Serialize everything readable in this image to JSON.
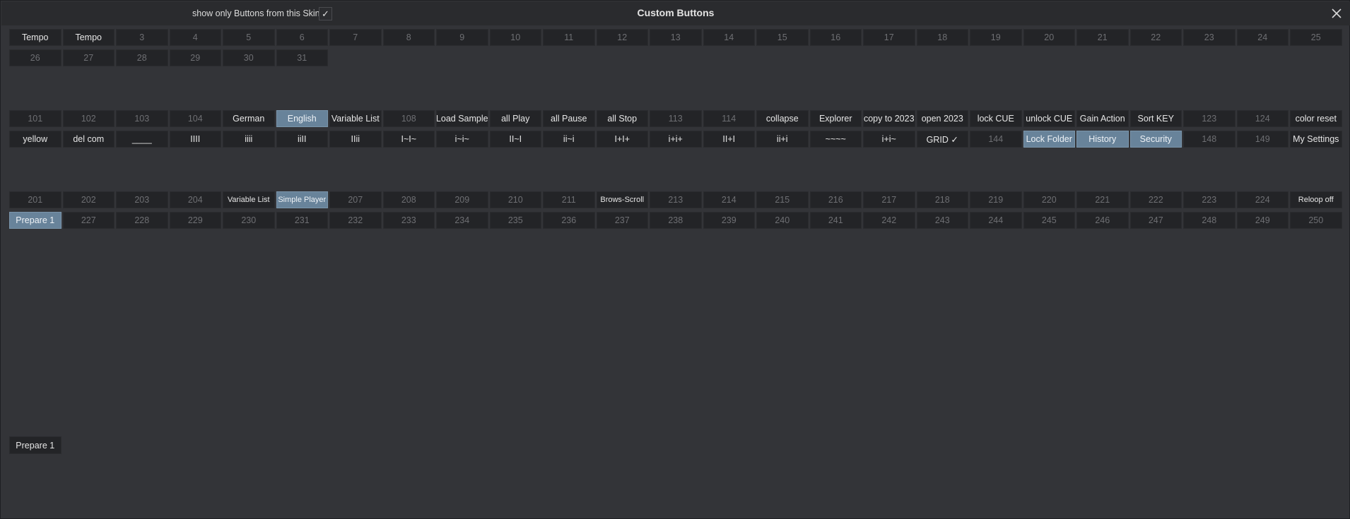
{
  "window": {
    "title": "Custom Buttons",
    "skin_filter_label": "show only Buttons from this Skin",
    "skin_filter_checked": "✓"
  },
  "groups": [
    [
      [
        {
          "label": "Tempo",
          "state": "assigned"
        },
        {
          "label": "Tempo",
          "state": "assigned"
        },
        {
          "label": "3",
          "state": "empty"
        },
        {
          "label": "4",
          "state": "empty"
        },
        {
          "label": "5",
          "state": "empty"
        },
        {
          "label": "6",
          "state": "empty"
        },
        {
          "label": "7",
          "state": "empty"
        },
        {
          "label": "8",
          "state": "empty"
        },
        {
          "label": "9",
          "state": "empty"
        },
        {
          "label": "10",
          "state": "empty"
        },
        {
          "label": "11",
          "state": "empty"
        },
        {
          "label": "12",
          "state": "empty"
        },
        {
          "label": "13",
          "state": "empty"
        },
        {
          "label": "14",
          "state": "empty"
        },
        {
          "label": "15",
          "state": "empty"
        },
        {
          "label": "16",
          "state": "empty"
        },
        {
          "label": "17",
          "state": "empty"
        },
        {
          "label": "18",
          "state": "empty"
        },
        {
          "label": "19",
          "state": "empty"
        },
        {
          "label": "20",
          "state": "empty"
        },
        {
          "label": "21",
          "state": "empty"
        },
        {
          "label": "22",
          "state": "empty"
        },
        {
          "label": "23",
          "state": "empty"
        },
        {
          "label": "24",
          "state": "empty"
        },
        {
          "label": "25",
          "state": "empty"
        }
      ],
      [
        {
          "label": "26",
          "state": "empty"
        },
        {
          "label": "27",
          "state": "empty"
        },
        {
          "label": "28",
          "state": "empty"
        },
        {
          "label": "29",
          "state": "empty"
        },
        {
          "label": "30",
          "state": "empty"
        },
        {
          "label": "31",
          "state": "empty"
        }
      ]
    ],
    [
      [
        {
          "label": "101",
          "state": "empty"
        },
        {
          "label": "102",
          "state": "empty"
        },
        {
          "label": "103",
          "state": "empty"
        },
        {
          "label": "104",
          "state": "empty"
        },
        {
          "label": "German",
          "state": "assigned"
        },
        {
          "label": "English",
          "state": "active"
        },
        {
          "label": "Variable List",
          "state": "assigned"
        },
        {
          "label": "108",
          "state": "empty"
        },
        {
          "label": "Load Sample",
          "state": "assigned"
        },
        {
          "label": "all Play",
          "state": "assigned"
        },
        {
          "label": "all Pause",
          "state": "assigned"
        },
        {
          "label": "all Stop",
          "state": "assigned"
        },
        {
          "label": "113",
          "state": "empty"
        },
        {
          "label": "114",
          "state": "empty"
        },
        {
          "label": "collapse",
          "state": "assigned"
        },
        {
          "label": "Explorer",
          "state": "assigned"
        },
        {
          "label": "copy to 2023",
          "state": "assigned"
        },
        {
          "label": "open 2023",
          "state": "assigned"
        },
        {
          "label": "lock CUE",
          "state": "assigned"
        },
        {
          "label": "unlock CUE",
          "state": "assigned"
        },
        {
          "label": "Gain Action",
          "state": "assigned"
        },
        {
          "label": "Sort KEY",
          "state": "assigned"
        },
        {
          "label": "123",
          "state": "empty"
        },
        {
          "label": "124",
          "state": "empty"
        },
        {
          "label": "color reset",
          "state": "assigned"
        }
      ],
      [
        {
          "label": "yellow",
          "state": "assigned"
        },
        {
          "label": "del com",
          "state": "assigned"
        },
        {
          "label": "____",
          "state": "assigned"
        },
        {
          "label": "IIII",
          "state": "assigned"
        },
        {
          "label": "iiii",
          "state": "assigned"
        },
        {
          "label": "iiII",
          "state": "assigned"
        },
        {
          "label": "IIii",
          "state": "assigned"
        },
        {
          "label": "I~I~",
          "state": "assigned"
        },
        {
          "label": "i~i~",
          "state": "assigned"
        },
        {
          "label": "II~I",
          "state": "assigned"
        },
        {
          "label": "ii~i",
          "state": "assigned"
        },
        {
          "label": "I+I+",
          "state": "assigned"
        },
        {
          "label": "i+i+",
          "state": "assigned"
        },
        {
          "label": "II+I",
          "state": "assigned"
        },
        {
          "label": "ii+i",
          "state": "assigned"
        },
        {
          "label": "~~~~",
          "state": "assigned"
        },
        {
          "label": "i+i~",
          "state": "assigned"
        },
        {
          "label": "GRID ✓",
          "state": "assigned"
        },
        {
          "label": "144",
          "state": "empty"
        },
        {
          "label": "Lock Folder",
          "state": "active"
        },
        {
          "label": "History",
          "state": "active"
        },
        {
          "label": "Security",
          "state": "active"
        },
        {
          "label": "148",
          "state": "empty"
        },
        {
          "label": "149",
          "state": "empty"
        },
        {
          "label": "My Settings",
          "state": "assigned"
        }
      ]
    ],
    [
      [
        {
          "label": "201",
          "state": "empty"
        },
        {
          "label": "202",
          "state": "empty"
        },
        {
          "label": "203",
          "state": "empty"
        },
        {
          "label": "204",
          "state": "empty"
        },
        {
          "label": "Variable List",
          "state": "assigned",
          "small": true
        },
        {
          "label": "Simple Player",
          "state": "active",
          "small": true
        },
        {
          "label": "207",
          "state": "empty"
        },
        {
          "label": "208",
          "state": "empty"
        },
        {
          "label": "209",
          "state": "empty"
        },
        {
          "label": "210",
          "state": "empty"
        },
        {
          "label": "211",
          "state": "empty"
        },
        {
          "label": "Brows-Scroll",
          "state": "assigned",
          "small": true
        },
        {
          "label": "213",
          "state": "empty"
        },
        {
          "label": "214",
          "state": "empty"
        },
        {
          "label": "215",
          "state": "empty"
        },
        {
          "label": "216",
          "state": "empty"
        },
        {
          "label": "217",
          "state": "empty"
        },
        {
          "label": "218",
          "state": "empty"
        },
        {
          "label": "219",
          "state": "empty"
        },
        {
          "label": "220",
          "state": "empty"
        },
        {
          "label": "221",
          "state": "empty"
        },
        {
          "label": "222",
          "state": "empty"
        },
        {
          "label": "223",
          "state": "empty"
        },
        {
          "label": "224",
          "state": "empty"
        },
        {
          "label": "Reloop off",
          "state": "assigned",
          "small": true
        }
      ],
      [
        {
          "label": "Prepare 1",
          "state": "active"
        },
        {
          "label": "227",
          "state": "empty"
        },
        {
          "label": "228",
          "state": "empty"
        },
        {
          "label": "229",
          "state": "empty"
        },
        {
          "label": "230",
          "state": "empty"
        },
        {
          "label": "231",
          "state": "empty"
        },
        {
          "label": "232",
          "state": "empty"
        },
        {
          "label": "233",
          "state": "empty"
        },
        {
          "label": "234",
          "state": "empty"
        },
        {
          "label": "235",
          "state": "empty"
        },
        {
          "label": "236",
          "state": "empty"
        },
        {
          "label": "237",
          "state": "empty"
        },
        {
          "label": "238",
          "state": "empty"
        },
        {
          "label": "239",
          "state": "empty"
        },
        {
          "label": "240",
          "state": "empty"
        },
        {
          "label": "241",
          "state": "empty"
        },
        {
          "label": "242",
          "state": "empty"
        },
        {
          "label": "243",
          "state": "empty"
        },
        {
          "label": "244",
          "state": "empty"
        },
        {
          "label": "245",
          "state": "empty"
        },
        {
          "label": "246",
          "state": "empty"
        },
        {
          "label": "247",
          "state": "empty"
        },
        {
          "label": "248",
          "state": "empty"
        },
        {
          "label": "249",
          "state": "empty"
        },
        {
          "label": "250",
          "state": "empty"
        }
      ]
    ]
  ],
  "preview_button": {
    "label": "Prepare 1"
  },
  "colors": {
    "background": "#333438",
    "button": "#232427",
    "active_button": "#68839a",
    "empty_text": "#6e6f73"
  }
}
